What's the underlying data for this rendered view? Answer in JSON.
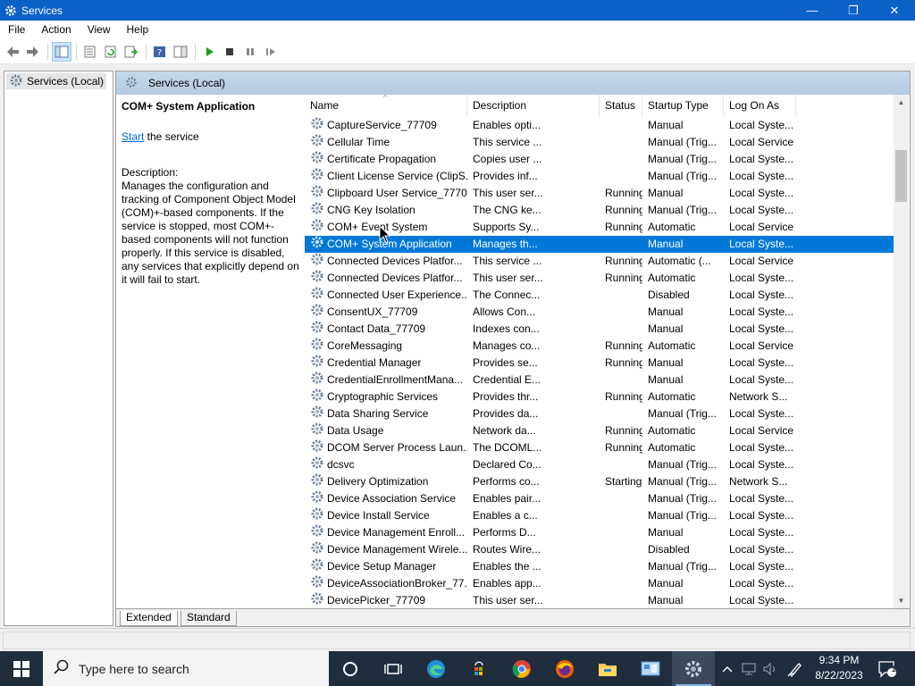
{
  "window": {
    "title": "Services",
    "minimize_glyph": "—",
    "maximize_glyph": "❐",
    "close_glyph": "✕"
  },
  "menu": [
    "File",
    "Action",
    "View",
    "Help"
  ],
  "tree": {
    "root_label": "Services (Local)"
  },
  "banner": {
    "title": "Services (Local)"
  },
  "details": {
    "service_title": "COM+ System Application",
    "start_link": "Start",
    "start_suffix": " the service",
    "description_label": "Description:",
    "description_text": "Manages the configuration and tracking of Component Object Model (COM)+-based components. If the service is stopped, most COM+-based components will not function properly. If this service is disabled, any services that explicitly depend on it will fail to start."
  },
  "columns": [
    "Name",
    "Description",
    "Status",
    "Startup Type",
    "Log On As"
  ],
  "rows": [
    {
      "name": "CaptureService_77709",
      "desc": "Enables opti...",
      "status": "",
      "startup": "Manual",
      "logon": "Local Syste...",
      "selected": false
    },
    {
      "name": "Cellular Time",
      "desc": "This service ...",
      "status": "",
      "startup": "Manual (Trig...",
      "logon": "Local Service",
      "selected": false
    },
    {
      "name": "Certificate Propagation",
      "desc": "Copies user ...",
      "status": "",
      "startup": "Manual (Trig...",
      "logon": "Local Syste...",
      "selected": false
    },
    {
      "name": "Client License Service (ClipS...",
      "desc": "Provides inf...",
      "status": "",
      "startup": "Manual (Trig...",
      "logon": "Local Syste...",
      "selected": false
    },
    {
      "name": "Clipboard User Service_77709",
      "desc": "This user ser...",
      "status": "Running",
      "startup": "Manual",
      "logon": "Local Syste...",
      "selected": false
    },
    {
      "name": "CNG Key Isolation",
      "desc": "The CNG ke...",
      "status": "Running",
      "startup": "Manual (Trig...",
      "logon": "Local Syste...",
      "selected": false
    },
    {
      "name": "COM+ Event System",
      "desc": "Supports Sy...",
      "status": "Running",
      "startup": "Automatic",
      "logon": "Local Service",
      "selected": false
    },
    {
      "name": "COM+ System Application",
      "desc": "Manages th...",
      "status": "",
      "startup": "Manual",
      "logon": "Local Syste...",
      "selected": true
    },
    {
      "name": "Connected Devices Platfor...",
      "desc": "This service ...",
      "status": "Running",
      "startup": "Automatic (...",
      "logon": "Local Service",
      "selected": false
    },
    {
      "name": "Connected Devices Platfor...",
      "desc": "This user ser...",
      "status": "Running",
      "startup": "Automatic",
      "logon": "Local Syste...",
      "selected": false
    },
    {
      "name": "Connected User Experience...",
      "desc": "The Connec...",
      "status": "",
      "startup": "Disabled",
      "logon": "Local Syste...",
      "selected": false
    },
    {
      "name": "ConsentUX_77709",
      "desc": "Allows Con...",
      "status": "",
      "startup": "Manual",
      "logon": "Local Syste...",
      "selected": false
    },
    {
      "name": "Contact Data_77709",
      "desc": "Indexes con...",
      "status": "",
      "startup": "Manual",
      "logon": "Local Syste...",
      "selected": false
    },
    {
      "name": "CoreMessaging",
      "desc": "Manages co...",
      "status": "Running",
      "startup": "Automatic",
      "logon": "Local Service",
      "selected": false
    },
    {
      "name": "Credential Manager",
      "desc": "Provides se...",
      "status": "Running",
      "startup": "Manual",
      "logon": "Local Syste...",
      "selected": false
    },
    {
      "name": "CredentialEnrollmentMana...",
      "desc": "Credential E...",
      "status": "",
      "startup": "Manual",
      "logon": "Local Syste...",
      "selected": false
    },
    {
      "name": "Cryptographic Services",
      "desc": "Provides thr...",
      "status": "Running",
      "startup": "Automatic",
      "logon": "Network S...",
      "selected": false
    },
    {
      "name": "Data Sharing Service",
      "desc": "Provides da...",
      "status": "",
      "startup": "Manual (Trig...",
      "logon": "Local Syste...",
      "selected": false
    },
    {
      "name": "Data Usage",
      "desc": "Network da...",
      "status": "Running",
      "startup": "Automatic",
      "logon": "Local Service",
      "selected": false
    },
    {
      "name": "DCOM Server Process Laun...",
      "desc": "The DCOML...",
      "status": "Running",
      "startup": "Automatic",
      "logon": "Local Syste...",
      "selected": false
    },
    {
      "name": "dcsvc",
      "desc": "Declared Co...",
      "status": "",
      "startup": "Manual (Trig...",
      "logon": "Local Syste...",
      "selected": false
    },
    {
      "name": "Delivery Optimization",
      "desc": "Performs co...",
      "status": "Starting",
      "startup": "Manual (Trig...",
      "logon": "Network S...",
      "selected": false
    },
    {
      "name": "Device Association Service",
      "desc": "Enables pair...",
      "status": "",
      "startup": "Manual (Trig...",
      "logon": "Local Syste...",
      "selected": false
    },
    {
      "name": "Device Install Service",
      "desc": "Enables a c...",
      "status": "",
      "startup": "Manual (Trig...",
      "logon": "Local Syste...",
      "selected": false
    },
    {
      "name": "Device Management Enroll...",
      "desc": "Performs D...",
      "status": "",
      "startup": "Manual",
      "logon": "Local Syste...",
      "selected": false
    },
    {
      "name": "Device Management Wirele...",
      "desc": "Routes Wire...",
      "status": "",
      "startup": "Disabled",
      "logon": "Local Syste...",
      "selected": false
    },
    {
      "name": "Device Setup Manager",
      "desc": "Enables the ...",
      "status": "",
      "startup": "Manual (Trig...",
      "logon": "Local Syste...",
      "selected": false
    },
    {
      "name": "DeviceAssociationBroker_77...",
      "desc": "Enables app...",
      "status": "",
      "startup": "Manual",
      "logon": "Local Syste...",
      "selected": false
    },
    {
      "name": "DevicePicker_77709",
      "desc": "This user ser...",
      "status": "",
      "startup": "Manual",
      "logon": "Local Syste...",
      "selected": false
    }
  ],
  "tabs": [
    "Extended",
    "Standard"
  ],
  "taskbar": {
    "search_placeholder": "Type here to search",
    "time": "9:34 PM",
    "date": "8/22/2023",
    "notification_count": "1"
  },
  "colors": {
    "titlebar": "#0a62c7",
    "selection": "#0078d7",
    "taskbar": "#1f2d3d"
  }
}
